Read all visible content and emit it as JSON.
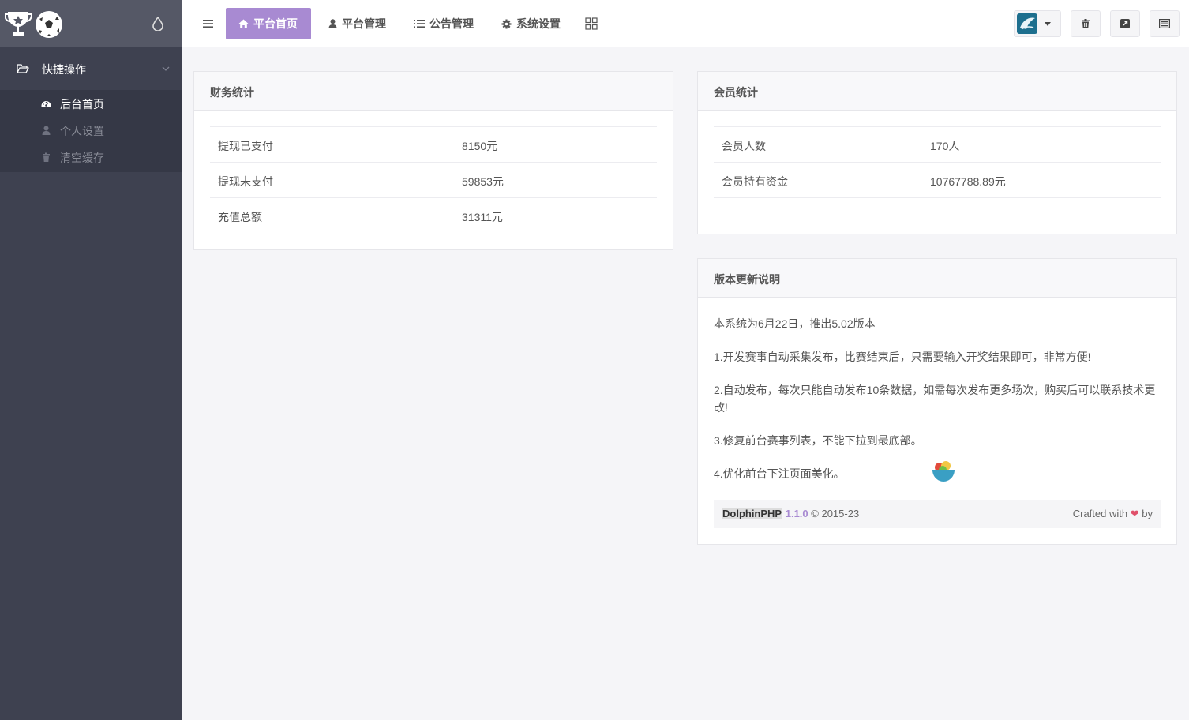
{
  "sidebar": {
    "group_label": "快捷操作",
    "items": [
      {
        "label": "后台首页",
        "icon": "dashboard-icon"
      },
      {
        "label": "个人设置",
        "icon": "user-icon"
      },
      {
        "label": "清空缓存",
        "icon": "trash-icon"
      }
    ]
  },
  "topbar": {
    "tabs": [
      {
        "label": "平台首页",
        "icon": "home-icon"
      },
      {
        "label": "平台管理",
        "icon": "user-icon"
      },
      {
        "label": "公告管理",
        "icon": "list-icon"
      },
      {
        "label": "系统设置",
        "icon": "gear-icon"
      }
    ]
  },
  "finance": {
    "title": "财务统计",
    "rows": [
      {
        "key": "提现已支付",
        "value": "8150元"
      },
      {
        "key": "提现未支付",
        "value": "59853元"
      },
      {
        "key": "充值总额",
        "value": "31311元"
      }
    ]
  },
  "members": {
    "title": "会员统计",
    "rows": [
      {
        "key": "会员人数",
        "value": "170人"
      },
      {
        "key": "会员持有资金",
        "value": "10767788.89元"
      }
    ]
  },
  "notes": {
    "title": "版本更新说明",
    "lines": [
      "本系统为6月22日，推出5.02版本",
      "1.开发赛事自动采集发布，比赛结束后，只需要输入开奖结果即可，非常方便!",
      "2.自动发布，每次只能自动发布10条数据，如需每次发布更多场次，购买后可以联系技术更改!",
      "3.修复前台赛事列表，不能下拉到最底部。",
      "4.优化前台下注页面美化。"
    ]
  },
  "footer": {
    "brand": "DolphinPHP",
    "version": "1.1.0",
    "copyright": "© 2015-23",
    "crafted": "Crafted with",
    "by": "by"
  },
  "colors": {
    "accent": "#a88ad2",
    "sidebar_bg": "#3e4150"
  }
}
